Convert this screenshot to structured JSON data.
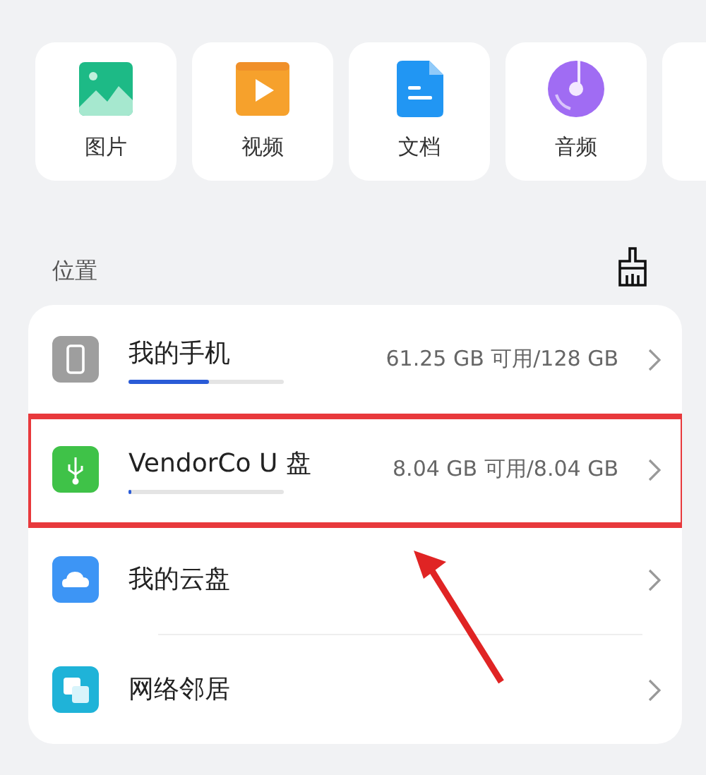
{
  "categories": [
    {
      "label": "图片",
      "kind": "image"
    },
    {
      "label": "视频",
      "kind": "video"
    },
    {
      "label": "文档",
      "kind": "document"
    },
    {
      "label": "音频",
      "kind": "audio"
    }
  ],
  "locations": {
    "title": "位置",
    "items": [
      {
        "name": "我的手机",
        "kind": "phone",
        "level": 0.52,
        "capacity": "61.25 GB 可用/128 GB",
        "highlighted": false
      },
      {
        "name": "VendorCo U 盘",
        "kind": "usb",
        "level": 0.02,
        "capacity": "8.04 GB 可用/8.04 GB",
        "highlighted": true
      },
      {
        "name": "我的云盘",
        "kind": "cloud",
        "highlighted": false
      },
      {
        "name": "网络邻居",
        "kind": "network",
        "highlighted": false
      }
    ]
  }
}
